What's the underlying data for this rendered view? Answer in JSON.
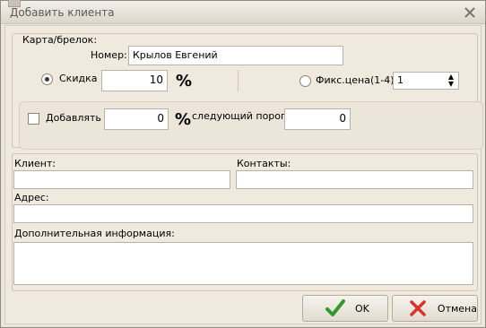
{
  "window": {
    "title": "Добавить клиента"
  },
  "card": {
    "legend": "Карта/брелок:",
    "number_label": "Номер:",
    "number_value": "Крылов Евгений",
    "discount_label": "Скидка",
    "discount_value": "10",
    "percent_sign": "%",
    "discount_selected": true,
    "fixed_price_label": "Фикс.цена(1-4):",
    "fixed_price_value": "1",
    "fixed_price_selected": false
  },
  "accumulate": {
    "checked": false,
    "label": "Добавлять",
    "value": "0",
    "percent_sign": "%",
    "threshold_label": "следующий порог",
    "threshold_value": "0"
  },
  "client": {
    "client_label": "Клиент:",
    "client_value": "",
    "contacts_label": "Контакты:",
    "contacts_value": "",
    "address_label": "Адрес:",
    "address_value": "",
    "extra_label": "Дополнительная информация:",
    "extra_value": ""
  },
  "buttons": {
    "ok_label": "OK",
    "cancel_label": "Отмена"
  },
  "icons": {
    "close": "close-icon",
    "ok": "check-icon",
    "cancel": "x-icon"
  },
  "colors": {
    "ok_green": "#2e9b2a",
    "cancel_red": "#d9342b"
  }
}
